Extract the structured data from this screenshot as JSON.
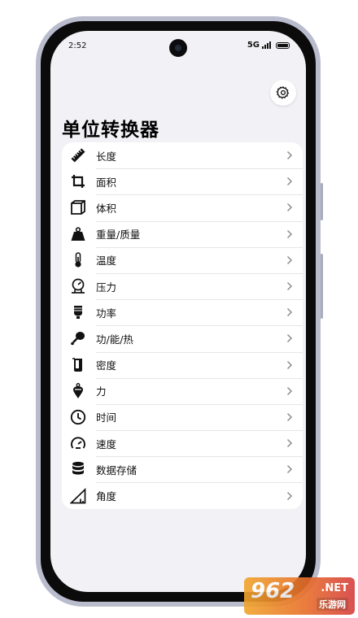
{
  "status_bar": {
    "time": "2:52",
    "network": "5G"
  },
  "app": {
    "title": "单位转换器"
  },
  "header": {
    "settings_icon": "gear-icon"
  },
  "categories": [
    {
      "label": "长度",
      "icon": "ruler-icon"
    },
    {
      "label": "面积",
      "icon": "crop-icon"
    },
    {
      "label": "体积",
      "icon": "cube-icon"
    },
    {
      "label": "重量/质量",
      "icon": "weight-icon"
    },
    {
      "label": "温度",
      "icon": "thermometer-icon"
    },
    {
      "label": "压力",
      "icon": "pressure-gauge-icon"
    },
    {
      "label": "功率",
      "icon": "bulb-icon"
    },
    {
      "label": "功/能/热",
      "icon": "drumstick-icon"
    },
    {
      "label": "密度",
      "icon": "beaker-icon"
    },
    {
      "label": "力",
      "icon": "plumb-bob-icon"
    },
    {
      "label": "时间",
      "icon": "clock-icon"
    },
    {
      "label": "速度",
      "icon": "speedometer-icon"
    },
    {
      "label": "数据存储",
      "icon": "database-icon"
    },
    {
      "label": "角度",
      "icon": "set-square-icon"
    }
  ],
  "watermark": {
    "brand": "962",
    "suffix": ".NET",
    "sub": "乐游网"
  },
  "colors": {
    "background": "#f2f2f6",
    "card": "#ffffff",
    "text": "#111111",
    "chevron": "#8e8e93"
  }
}
